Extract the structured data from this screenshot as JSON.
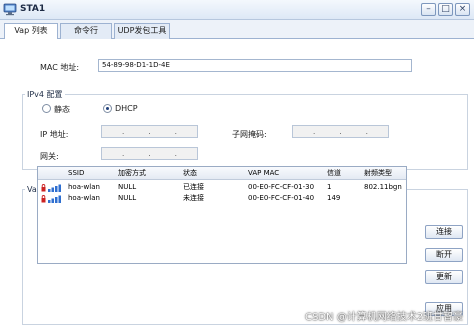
{
  "window": {
    "title": "STA1"
  },
  "tabs": [
    {
      "label": "Vap 列表",
      "active": true
    },
    {
      "label": "命令行",
      "active": false
    },
    {
      "label": "UDP发包工具",
      "active": false
    }
  ],
  "mac": {
    "label": "MAC 地址:",
    "value": "54-89-98-D1-1D-4E"
  },
  "ipv4": {
    "legend": "IPv4 配置",
    "static_label": "静态",
    "dhcp_label": "DHCP",
    "selected": "DHCP",
    "ip_label": "IP 地址:",
    "mask_label": "子网掩码:",
    "gateway_label": "网关:",
    "ip_dots": [
      ".",
      ".",
      "."
    ],
    "mask_dots": [
      ".",
      ".",
      "."
    ],
    "gateway_dots": [
      ".",
      ".",
      "."
    ]
  },
  "vap": {
    "legend": "Vap 列表",
    "columns": [
      "SSID",
      "加密方式",
      "状态",
      "VAP MAC",
      "信道",
      "射频类型"
    ],
    "rows": [
      [
        "hoa-wlan",
        "NULL",
        "已连接",
        "00-E0-FC-CF-01-30",
        "1",
        "802.11bgn"
      ],
      [
        "hoa-wlan",
        "NULL",
        "未连接",
        "00-E0-FC-CF-01-40",
        "149",
        ""
      ]
    ]
  },
  "buttons": {
    "connect": "连接",
    "disconnect": "断开",
    "refresh": "更新",
    "apply": "应用"
  },
  "watermark": "CSDN @计算机网络技术2班甘智豪",
  "colors": {
    "title_bar": "#dde8f6",
    "border": "#9db2d1",
    "lock_icon": "#cc2222",
    "signal_icon": "#2f6fd0"
  }
}
